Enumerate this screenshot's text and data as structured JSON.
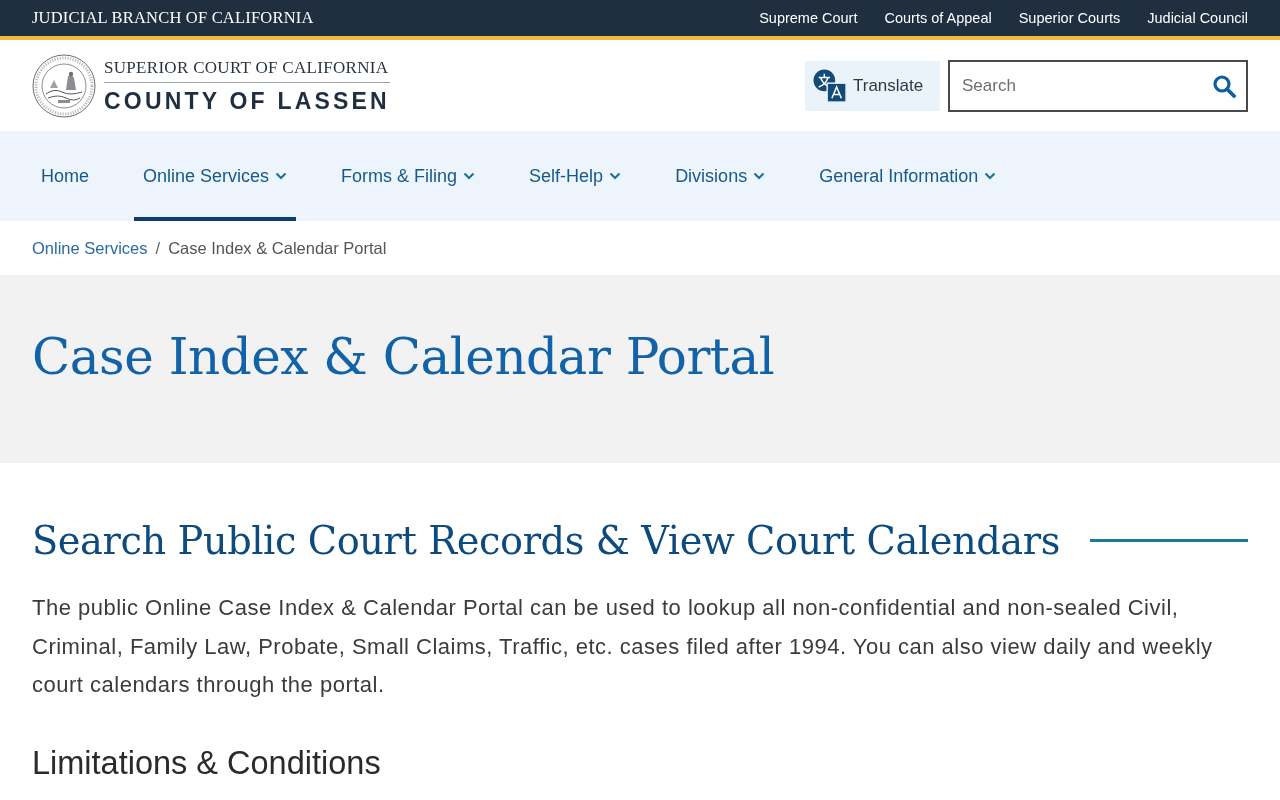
{
  "top_bar": {
    "title": "JUDICIAL BRANCH OF CALIFORNIA",
    "links": [
      "Supreme Court",
      "Courts of Appeal",
      "Superior Courts",
      "Judicial Council"
    ]
  },
  "header": {
    "logo": {
      "line_1": "SUPERIOR COURT OF CALIFORNIA",
      "line_2": "COUNTY OF LASSEN"
    },
    "translate_button": "Translate",
    "search": {
      "placeholder": "Search"
    }
  },
  "nav": {
    "items": [
      {
        "label": "Home",
        "has_menu": false,
        "selected": false
      },
      {
        "label": "Online Services",
        "has_menu": true,
        "selected": true
      },
      {
        "label": "Forms & Filing",
        "has_menu": true,
        "selected": false
      },
      {
        "label": "Self-Help",
        "has_menu": true,
        "selected": false
      },
      {
        "label": "Divisions",
        "has_menu": true,
        "selected": false
      },
      {
        "label": "General Information",
        "has_menu": true,
        "selected": false
      }
    ]
  },
  "breadcrumb": {
    "separator": "/",
    "items": [
      {
        "label": "Online Services",
        "kind": "link"
      },
      {
        "label": "Case Index & Calendar Portal",
        "kind": "current"
      }
    ]
  },
  "page_title": "Case Index & Calendar Portal",
  "section": {
    "heading": "Search Public Court Records & View Court Calendars",
    "paragraph": "The public Online Case Index & Calendar Portal can be used to lookup all non-confidential and non-sealed Civil, Criminal, Family Law, Probate, Small Claims, Traffic, etc. cases filed after 1994. You can also view daily and weekly court calendars through the portal.",
    "subheading": "Limitations & Conditions"
  }
}
